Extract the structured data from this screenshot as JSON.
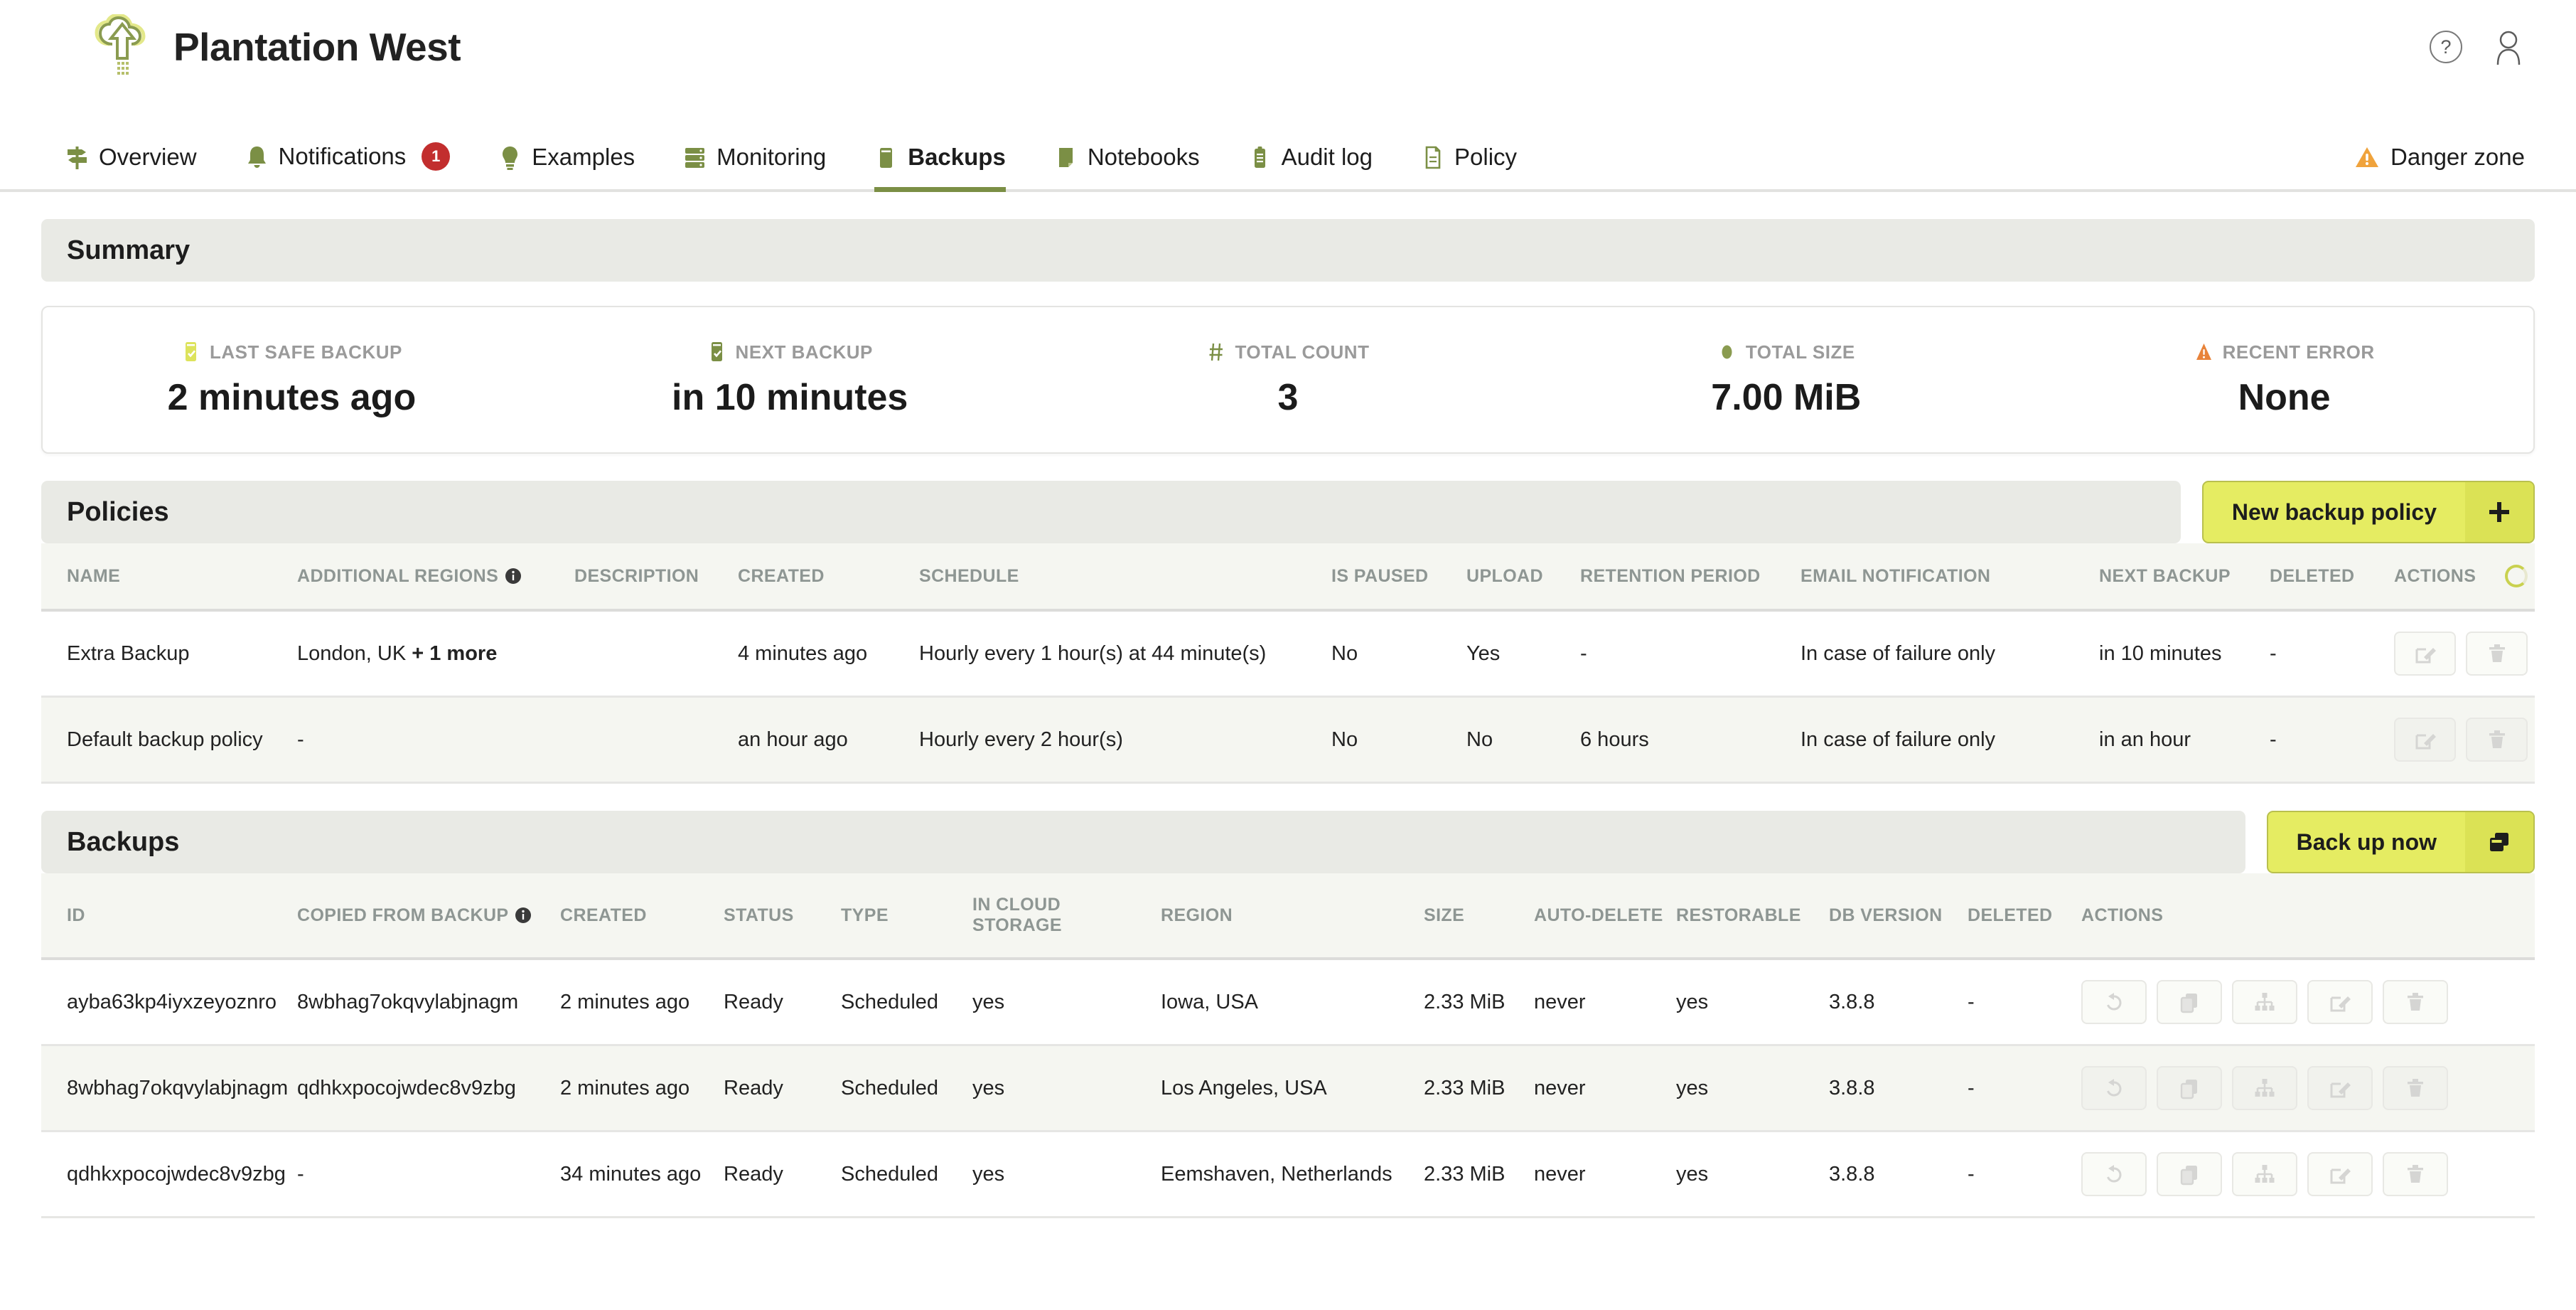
{
  "header": {
    "brand_name": "Plantation West",
    "help_label": "?",
    "logo_icon": "cloud-upload-icon",
    "avatar_icon": "user-avatar-icon"
  },
  "nav": {
    "items": [
      {
        "label": "Overview",
        "icon": "signpost-icon",
        "active": false,
        "badge": null
      },
      {
        "label": "Notifications",
        "icon": "bell-icon",
        "active": false,
        "badge": "1"
      },
      {
        "label": "Examples",
        "icon": "lightbulb-icon",
        "active": false,
        "badge": null
      },
      {
        "label": "Monitoring",
        "icon": "server-icon",
        "active": false,
        "badge": null
      },
      {
        "label": "Backups",
        "icon": "database-icon",
        "active": true,
        "badge": null
      },
      {
        "label": "Notebooks",
        "icon": "notebook-icon",
        "active": false,
        "badge": null
      },
      {
        "label": "Audit log",
        "icon": "clipboard-icon",
        "active": false,
        "badge": null
      },
      {
        "label": "Policy",
        "icon": "document-icon",
        "active": false,
        "badge": null
      }
    ],
    "danger_zone": {
      "label": "Danger zone",
      "icon": "warning-triangle-icon"
    }
  },
  "summary": {
    "title": "Summary",
    "cells": [
      {
        "label": "LAST SAFE BACKUP",
        "value": "2 minutes ago",
        "icon": "database-check-icon",
        "icon_color": "#dde35c"
      },
      {
        "label": "NEXT BACKUP",
        "value": "in 10 minutes",
        "icon": "database-check-icon",
        "icon_color": "#7b8f45"
      },
      {
        "label": "TOTAL COUNT",
        "value": "3",
        "icon": "hash-icon",
        "icon_color": "#7b8f45"
      },
      {
        "label": "TOTAL SIZE",
        "value": "7.00 MiB",
        "icon": "circle-icon",
        "icon_color": "#8a9b50"
      },
      {
        "label": "RECENT ERROR",
        "value": "None",
        "icon": "warning-triangle-icon",
        "icon_color": "#e8833a"
      }
    ]
  },
  "policies": {
    "title": "Policies",
    "new_button": {
      "label": "New backup policy",
      "icon": "plus-icon"
    },
    "columns": [
      {
        "label": "NAME",
        "info": false
      },
      {
        "label": "ADDITIONAL REGIONS",
        "info": true
      },
      {
        "label": "DESCRIPTION",
        "info": false
      },
      {
        "label": "CREATED",
        "info": false
      },
      {
        "label": "SCHEDULE",
        "info": false
      },
      {
        "label": "IS PAUSED",
        "info": false
      },
      {
        "label": "UPLOAD",
        "info": false
      },
      {
        "label": "RETENTION PERIOD",
        "info": false
      },
      {
        "label": "EMAIL NOTIFICATION",
        "info": false
      },
      {
        "label": "NEXT BACKUP",
        "info": false
      },
      {
        "label": "DELETED",
        "info": false
      },
      {
        "label": "ACTIONS",
        "info": false
      }
    ],
    "row_actions": [
      "edit-icon",
      "delete-icon"
    ],
    "rows": [
      {
        "name": "Extra Backup",
        "additional_regions": "London, UK",
        "additional_regions_more": "+ 1 more",
        "description": "",
        "created": "4 minutes ago",
        "schedule": "Hourly every 1 hour(s) at 44 minute(s)",
        "is_paused": "No",
        "upload": "Yes",
        "retention_period": "-",
        "email_notification": "In case of failure only",
        "next_backup": "in 10 minutes",
        "deleted": "-"
      },
      {
        "name": "Default backup policy",
        "additional_regions": "-",
        "additional_regions_more": "",
        "description": "",
        "created": "an hour ago",
        "schedule": "Hourly every 2 hour(s)",
        "is_paused": "No",
        "upload": "No",
        "retention_period": "6 hours",
        "email_notification": "In case of failure only",
        "next_backup": "in an hour",
        "deleted": "-"
      }
    ]
  },
  "backups": {
    "title": "Backups",
    "backup_button": {
      "label": "Back up now",
      "icon": "copy-icon"
    },
    "columns": [
      {
        "label": "ID",
        "info": false
      },
      {
        "label": "COPIED FROM BACKUP",
        "info": true
      },
      {
        "label": "CREATED",
        "info": false
      },
      {
        "label": "STATUS",
        "info": false
      },
      {
        "label": "TYPE",
        "info": false
      },
      {
        "label": "IN CLOUD STORAGE",
        "info": false
      },
      {
        "label": "REGION",
        "info": false
      },
      {
        "label": "SIZE",
        "info": false
      },
      {
        "label": "AUTO-DELETE",
        "info": false
      },
      {
        "label": "RESTORABLE",
        "info": false
      },
      {
        "label": "DB VERSION",
        "info": false
      },
      {
        "label": "DELETED",
        "info": false
      },
      {
        "label": "ACTIONS",
        "info": false
      }
    ],
    "row_actions": [
      "restore-icon",
      "copy-icon",
      "fork-icon",
      "edit-icon",
      "delete-icon"
    ],
    "rows": [
      {
        "id": "ayba63kp4iyxzeyoznro",
        "copied_from_backup": "8wbhag7okqvylabjnagm",
        "created": "2 minutes ago",
        "status": "Ready",
        "type": "Scheduled",
        "in_cloud_storage": "yes",
        "region": "Iowa, USA",
        "size": "2.33 MiB",
        "auto_delete": "never",
        "restorable": "yes",
        "db_version": "3.8.8",
        "deleted": "-"
      },
      {
        "id": "8wbhag7okqvylabjnagm",
        "copied_from_backup": "qdhkxpocojwdec8v9zbg",
        "created": "2 minutes ago",
        "status": "Ready",
        "type": "Scheduled",
        "in_cloud_storage": "yes",
        "region": "Los Angeles, USA",
        "size": "2.33 MiB",
        "auto_delete": "never",
        "restorable": "yes",
        "db_version": "3.8.8",
        "deleted": "-"
      },
      {
        "id": "qdhkxpocojwdec8v9zbg",
        "copied_from_backup": "-",
        "created": "34 minutes ago",
        "status": "Ready",
        "type": "Scheduled",
        "in_cloud_storage": "yes",
        "region": "Eemshaven, Netherlands",
        "size": "2.33 MiB",
        "auto_delete": "never",
        "restorable": "yes",
        "db_version": "3.8.8",
        "deleted": "-"
      }
    ]
  },
  "colors": {
    "accent_green": "#7b8f45",
    "accent_yellow": "#e5ec62",
    "danger_red": "#c22e2e",
    "warning_orange": "#e8833a"
  }
}
